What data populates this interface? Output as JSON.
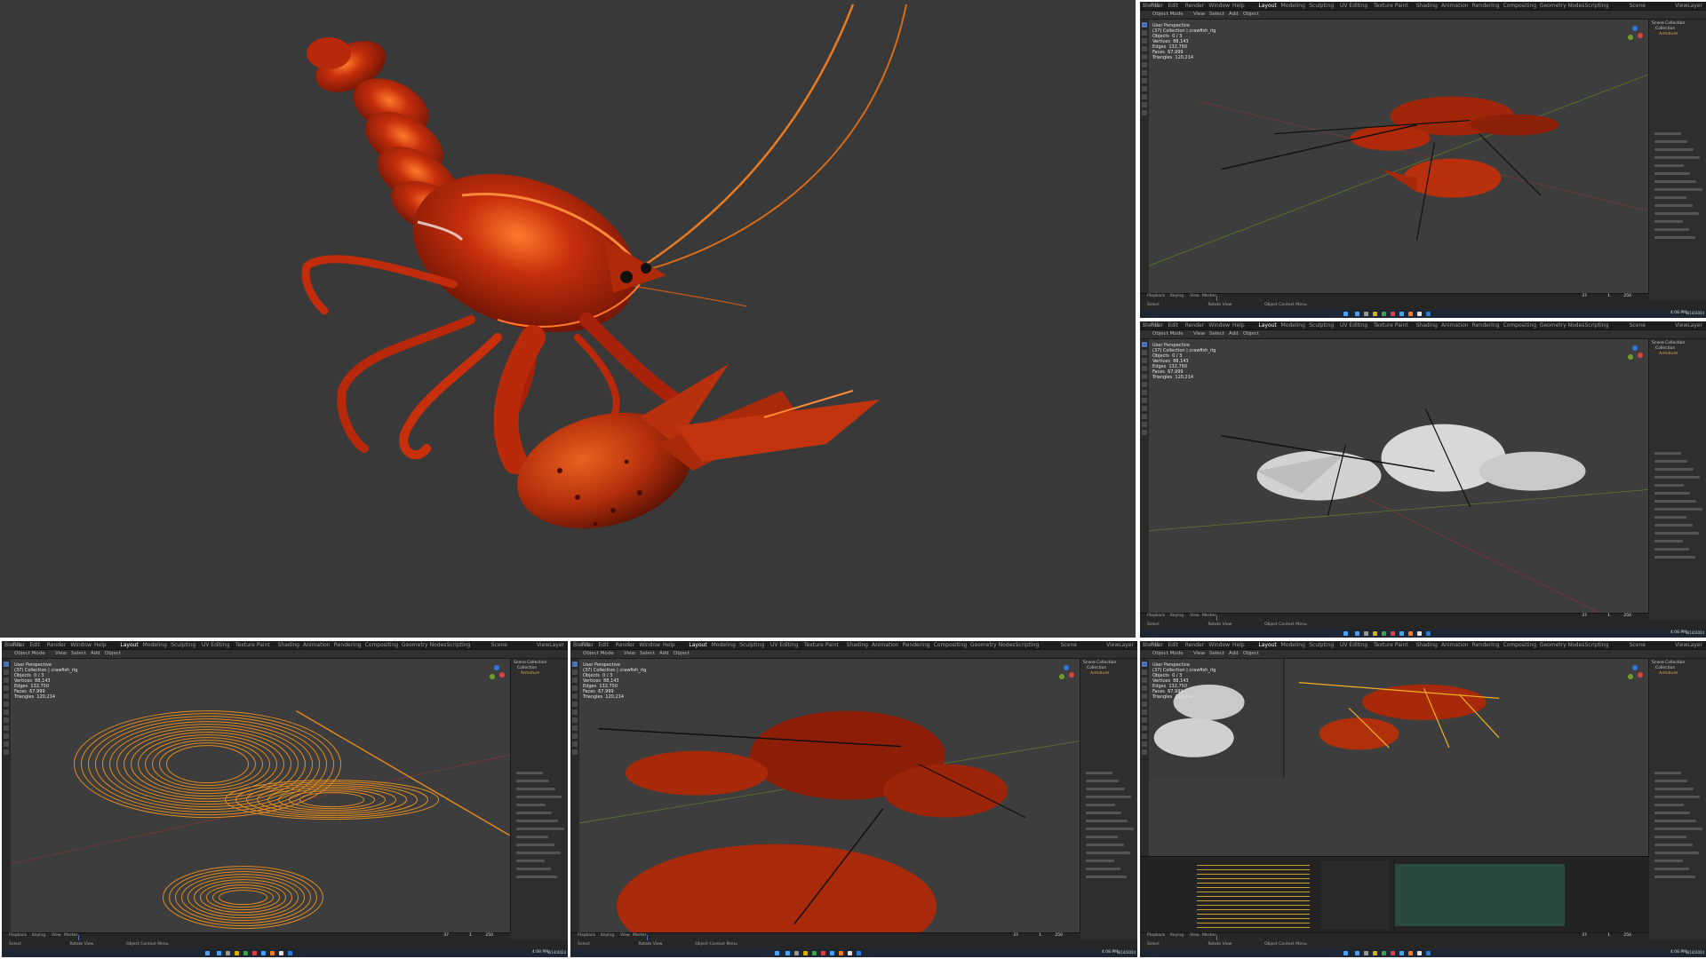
{
  "blender": {
    "app_name": "Blender",
    "menu": [
      "File",
      "Edit",
      "Render",
      "Window",
      "Help"
    ],
    "workspaces": [
      "Layout",
      "Modeling",
      "Sculpting",
      "UV Editing",
      "Texture Paint",
      "Shading",
      "Animation",
      "Rendering",
      "Compositing",
      "Geometry Nodes",
      "Scripting"
    ],
    "active_workspace": "Layout",
    "mode": "Object Mode",
    "view_menu": [
      "View",
      "Select",
      "Add",
      "Object"
    ],
    "viewport_label": "User Perspective",
    "collection_label": "(37) Collection | crawfish_rig",
    "stats": {
      "objects": "Objects  0 / 3",
      "vertices": "Vertices  88,143",
      "edges": "Edges  132,750",
      "faces": "Faces  67,999",
      "triangles": "Triangles  120,214"
    },
    "timeline": [
      "Playback",
      "Keying",
      "View",
      "Marker"
    ],
    "frame": "37",
    "start": "1",
    "end": "250",
    "scene": "Scene",
    "view_layer": "ViewLayer",
    "outliner": [
      "Scene Collection",
      "Collection",
      "Armature"
    ],
    "properties": [
      "Options",
      "Transform",
      "Affect Only",
      "Origins",
      "Locations",
      "Parents",
      "Workspace"
    ],
    "status_left": "Select",
    "status_mid": "Rotate View",
    "status_right": "Object Context Menu",
    "clock": "4:08 PM",
    "date": "8/14/2024"
  },
  "colors": {
    "accent": "#4772b3",
    "crawfish_red": "#a8200a",
    "crawfish_highlight": "#ff6a1a",
    "wire_orange": "#e08a20",
    "clay_grey": "#c9c9c9",
    "viewport_bg": "#3d3d3d"
  },
  "icons": {
    "axis_gizmo": "navigation-gizmo-icon",
    "tools": "toolbar-icon",
    "windows_start": "windows-start-icon"
  }
}
